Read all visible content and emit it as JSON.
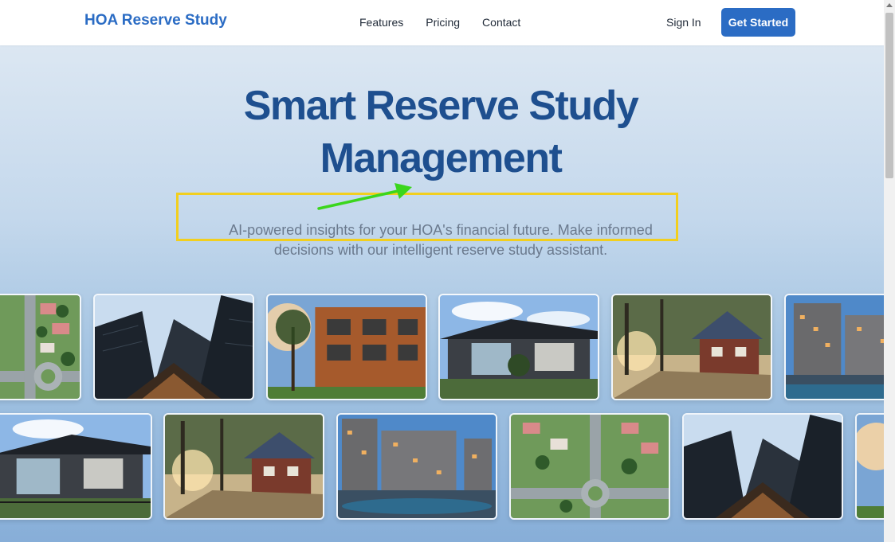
{
  "nav": {
    "brand": "HOA Reserve Study",
    "links": [
      "Features",
      "Pricing",
      "Contact"
    ],
    "sign_in": "Sign In",
    "get_started": "Get Started"
  },
  "hero": {
    "title_line1": "Smart Reserve Study",
    "title_line2": "Management",
    "subtitle_line1": "AI-powered insights for your HOA's financial future. Make informed",
    "subtitle_line2": "decisions with our intelligent reserve study assistant."
  },
  "annotation": {
    "box_color": "#f2cf1e",
    "arrow_color": "#3bd61c"
  },
  "gallery": {
    "row1": [
      "aerial-neighborhood-photo",
      "glass-skyscrapers-photo",
      "brick-apartment-sunset-photo",
      "modern-house-photo",
      "cottage-forest-photo",
      "apartment-complex-pool-photo"
    ],
    "row2": [
      "modern-house-photo",
      "cottage-forest-photo",
      "apartment-complex-pool-photo",
      "aerial-neighborhood-photo",
      "glass-skyscrapers-photo",
      "brick-apartment-sunset-photo"
    ]
  },
  "colors": {
    "brand": "#2b6cc4",
    "title": "#1e4f8f",
    "subtitle": "#6b7a8e"
  }
}
